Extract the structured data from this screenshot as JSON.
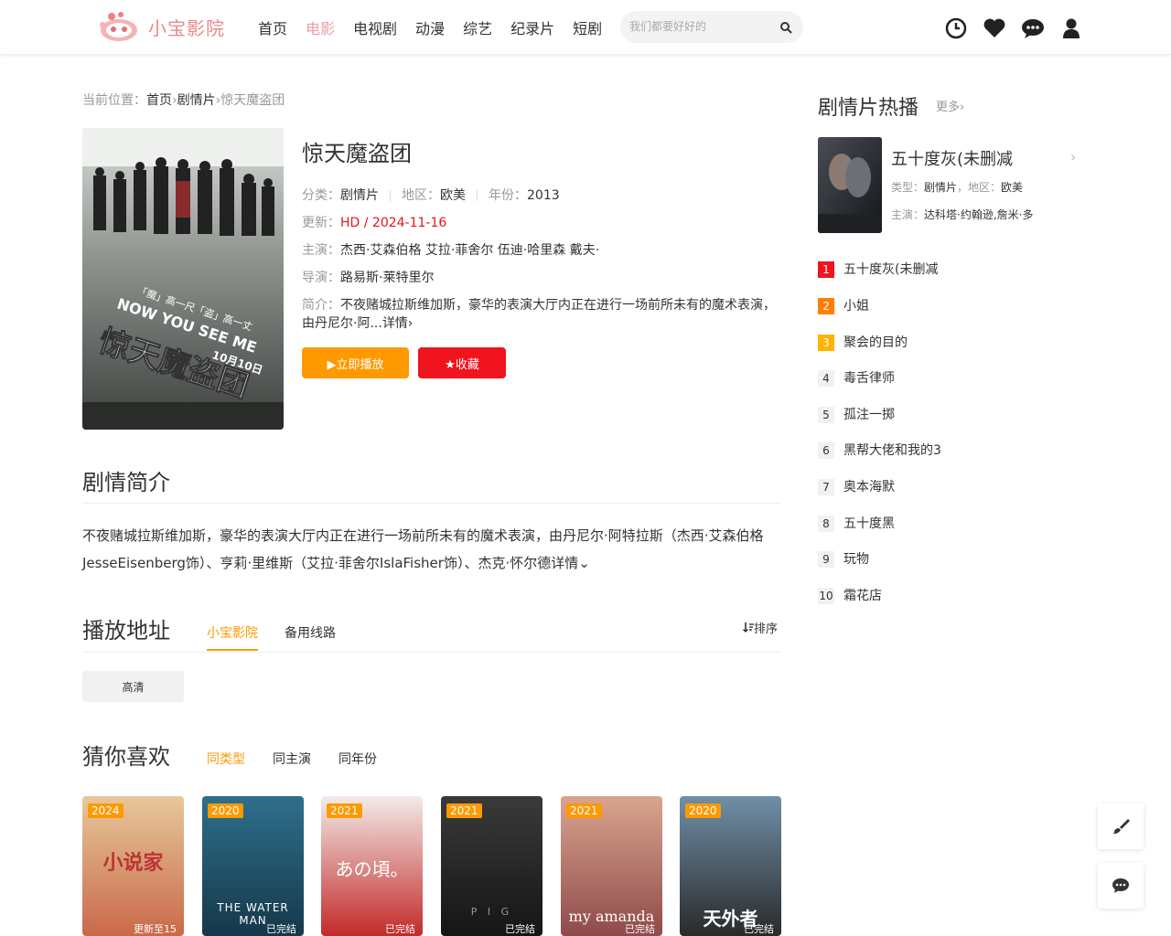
{
  "site": {
    "name": "小宝影院"
  },
  "nav": [
    "首页",
    "电影",
    "电视剧",
    "动漫",
    "综艺",
    "纪录片",
    "短剧"
  ],
  "search": {
    "placeholder": "我们都要好好的"
  },
  "header_icons": [
    "history-icon",
    "heart-icon",
    "chat-icon",
    "user-icon"
  ],
  "breadcrumb": {
    "prefix": "当前位置：",
    "home": "首页",
    "sep": "›",
    "category": "剧情片",
    "current": "惊天魔盗团"
  },
  "movie": {
    "title": "惊天魔盗团",
    "category_label": "分类：",
    "category": "剧情片",
    "region_label": "地区：",
    "region": "欧美",
    "year_label": "年份：",
    "year": "2013",
    "update_label": "更新：",
    "update": "HD / 2024-11-16",
    "cast_label": "主演：",
    "cast": "杰西·艾森伯格 艾拉·菲舍尔 伍迪·哈里森 戴夫·",
    "director_label": "导演：",
    "director": "路易斯·莱特里尔",
    "intro_label": "简介：",
    "intro": "不夜赌城拉斯维加斯，豪华的表演大厅内正在进行一场前所未有的魔术表演，由丹尼尔·阿...",
    "intro_more": "详情›",
    "play_button": "▶立即播放",
    "fav_button": "★收藏",
    "poster_text": {
      "tagline": "「魔」高一尺「盗」高一丈",
      "title_en": "NOW YOU SEE ME",
      "date": "10月10日",
      "title_cn": "惊天魔盗团"
    }
  },
  "plot": {
    "heading": "剧情简介",
    "text": "不夜赌城拉斯维加斯，豪华的表演大厅内正在进行一场前所未有的魔术表演，由丹尼尔·阿特拉斯（杰西·艾森伯格JesseEisenberg饰）、亨莉·里维斯（艾拉·菲舍尔IslaFisher饰）、杰克·怀尔德",
    "more": "详情⌄"
  },
  "play": {
    "heading": "播放地址",
    "tabs": [
      "小宝影院",
      "备用线路"
    ],
    "sort": "排序",
    "episodes": [
      "高清"
    ]
  },
  "recommend": {
    "heading": "猜你喜欢",
    "tabs": [
      "同类型",
      "同主演",
      "同年份"
    ],
    "items": [
      {
        "year": "2024",
        "note": "更新至15",
        "title_art": "小说家",
        "colors": [
          "#e7c89a",
          "#c9694a"
        ]
      },
      {
        "year": "2020",
        "note": "已完结",
        "title_art": "THE WATER MAN",
        "colors": [
          "#2f6f8c",
          "#15384a"
        ]
      },
      {
        "year": "2021",
        "note": "已完结",
        "title_art": "あの頃。",
        "colors": [
          "#f2ece8",
          "#c22a2a"
        ]
      },
      {
        "year": "2021",
        "note": "已完结",
        "title_art": "P I G",
        "colors": [
          "#3a3a3a",
          "#151515"
        ]
      },
      {
        "year": "2021",
        "note": "已完结",
        "title_art": "my amanda",
        "colors": [
          "#d9a58f",
          "#8f4a4a"
        ]
      },
      {
        "year": "2020",
        "note": "已完结",
        "title_art": "天外者",
        "colors": [
          "#6f8fa8",
          "#2a2a2a"
        ]
      }
    ]
  },
  "hot": {
    "heading": "剧情片热播",
    "more": "更多›",
    "featured": {
      "title": "五十度灰(未删减",
      "type_label": "类型：",
      "type": "剧情片",
      "region_label": "，地区：",
      "region": "欧美",
      "cast_label": "主演：",
      "cast": "达科塔·约翰逊,詹米·多"
    },
    "list": [
      "五十度灰(未删减",
      "小姐",
      "聚会的目的",
      "毒舌律师",
      "孤注一掷",
      "黑帮大佬和我的3",
      "奥本海默",
      "五十度黑",
      "玩物",
      "霜花店"
    ]
  },
  "colors": {
    "accent": "#ff9900",
    "red": "#f0141e",
    "nav_active": "#e8a0a0"
  }
}
